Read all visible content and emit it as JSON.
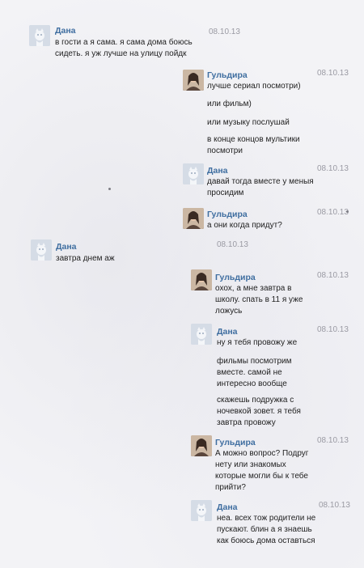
{
  "thread": {
    "messages": [
      {
        "author": "Дана",
        "date": "08.10.13",
        "avatar": "default",
        "lines": [
          "в гости а я сама. я сама дома боюсь",
          "сидеть. я уж лучше на улицу пойдк"
        ]
      },
      {
        "author": "Гульдира",
        "date": "08.10.13",
        "avatar": "photo",
        "lines": [
          "лучше сериал посмотри)",
          "или фильм)",
          "или музыку послушай",
          "в конце концов мультики",
          "посмотри"
        ]
      },
      {
        "author": "Дана",
        "date": "08.10.13",
        "avatar": "default",
        "lines": [
          "давай тогда вместе у меныя",
          "просидим"
        ]
      },
      {
        "author": "Гульдира",
        "date": "08.10.13",
        "avatar": "photo",
        "lines": [
          "а они когда придут?"
        ]
      },
      {
        "author": "Дана",
        "date": "08.10.13",
        "avatar": "default",
        "lines": [
          "завтра днем аж"
        ]
      },
      {
        "author": "Гульдира",
        "date": "08.10.13",
        "avatar": "photo",
        "lines": [
          "охох, а мне завтра в",
          "школу. спать в 11 я уже",
          "ложусь"
        ]
      },
      {
        "author": "Дана",
        "date": "08.10.13",
        "avatar": "default",
        "lines": [
          "ну я тебя провожу же",
          "фильмы посмотрим",
          "вместе. самой не",
          "интересно вообще",
          "скажешь подружка с",
          "ночевкой зовет. я тебя",
          "завтра провожу"
        ]
      },
      {
        "author": "Гульдира",
        "date": "08.10.13",
        "avatar": "photo",
        "lines": [
          "А можно вопрос? Подруг",
          "нету или знакомых",
          "которые могли бы к тебе",
          "прийти?"
        ]
      },
      {
        "author": "Дана",
        "date": "08.10.13",
        "avatar": "default",
        "lines": [
          "неа. всех тож родители не",
          "пускают. блин а я знаешь",
          "как боюсь дома оставться"
        ]
      }
    ]
  }
}
